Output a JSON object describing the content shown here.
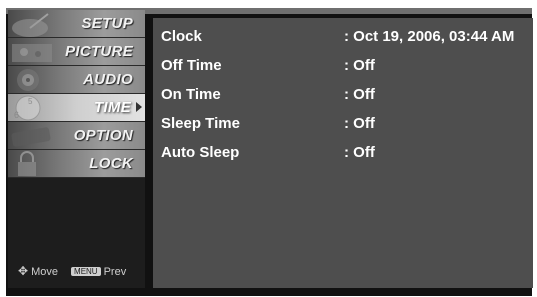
{
  "menu": {
    "items": [
      {
        "label": "SETUP",
        "icon": "satellite-dish-icon"
      },
      {
        "label": "PICTURE",
        "icon": "paint-icon"
      },
      {
        "label": "AUDIO",
        "icon": "speaker-icon"
      },
      {
        "label": "TIME",
        "icon": "clock-icon"
      },
      {
        "label": "OPTION",
        "icon": "option-icon"
      },
      {
        "label": "LOCK",
        "icon": "lock-icon"
      }
    ],
    "selected": "TIME"
  },
  "footer": {
    "move_label": "Move",
    "menu_key": "MENU",
    "prev_label": "Prev"
  },
  "settings": [
    {
      "name": "Clock",
      "value": ": Oct 19, 2006, 03:44 AM"
    },
    {
      "name": "Off Time",
      "value": ": Off"
    },
    {
      "name": "On Time",
      "value": ": Off"
    },
    {
      "name": "Sleep Time",
      "value": ": Off"
    },
    {
      "name": "Auto Sleep",
      "value": ": Off"
    }
  ],
  "colors": {
    "panel": "#4e4e4e",
    "sidebar": "#1d1d1d",
    "text": "#ffffff"
  }
}
